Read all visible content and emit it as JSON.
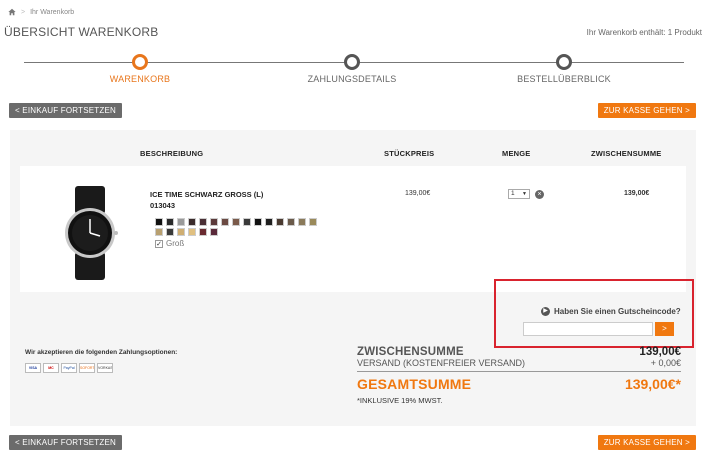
{
  "breadcrumb": {
    "home_icon": "home-icon",
    "current": "Ihr Warenkorb"
  },
  "header": {
    "title": "ÜBERSICHT WARENKORB",
    "cart_count": "Ihr Warenkorb enthält: 1 Produkt"
  },
  "steps": [
    {
      "label": "WARENKORB",
      "active": true
    },
    {
      "label": "ZAHLUNGSDETAILS",
      "active": false
    },
    {
      "label": "BESTELLÜBERBLICK",
      "active": false
    }
  ],
  "buttons": {
    "continue_shopping": "< EINKAUF FORTSETZEN",
    "checkout": "ZUR KASSE GEHEN >"
  },
  "table": {
    "headers": {
      "description": "BESCHREIBUNG",
      "unit_price": "STÜCKPREIS",
      "quantity": "MENGE",
      "subtotal": "ZWISCHENSUMME"
    }
  },
  "item": {
    "name": "ICE TIME SCHWARZ GROSS (L)",
    "sku": "013043",
    "unit_price": "139,00€",
    "quantity": "1",
    "subtotal": "139,00€",
    "size_option": "Groß",
    "swatches_row1": [
      "#111111",
      "#2a2a2a",
      "#9a9a9a",
      "#3a2b2b",
      "#4a2f35",
      "#5b3a3a",
      "#6b4a42",
      "#7a5a4a",
      "#3a3a3a",
      "#111111",
      "#1f1f1f",
      "#4a3a30",
      "#6a5a4a",
      "#8a7a5a",
      "#9a8a5a"
    ],
    "swatches_row2": [
      "#b8a070",
      "#3a3a3a",
      "#cfae72",
      "#e0c080",
      "#6a2a30",
      "#5a2a3a"
    ]
  },
  "voucher": {
    "question": "Haben Sie einen Gutscheincode?",
    "input_value": "",
    "button": ">"
  },
  "payment": {
    "label": "Wir akzeptieren die folgenden Zahlungsoptionen:",
    "cards": [
      "VISA",
      "MC",
      "PayPal",
      "SOFORT",
      "VORKASSE"
    ]
  },
  "totals": {
    "subtotal_label": "ZWISCHENSUMME",
    "subtotal_value": "139,00€",
    "shipping_label": "VERSAND (KOSTENFREIER VERSAND)",
    "shipping_value": "+ 0,00€",
    "total_label": "GESAMTSUMME",
    "total_value": "139,00€*",
    "vat_note": "*INKLUSIVE 19% MWST."
  },
  "colors": {
    "accent": "#f07810",
    "gray_button": "#6b6b6b",
    "highlight": "#d9232e"
  }
}
